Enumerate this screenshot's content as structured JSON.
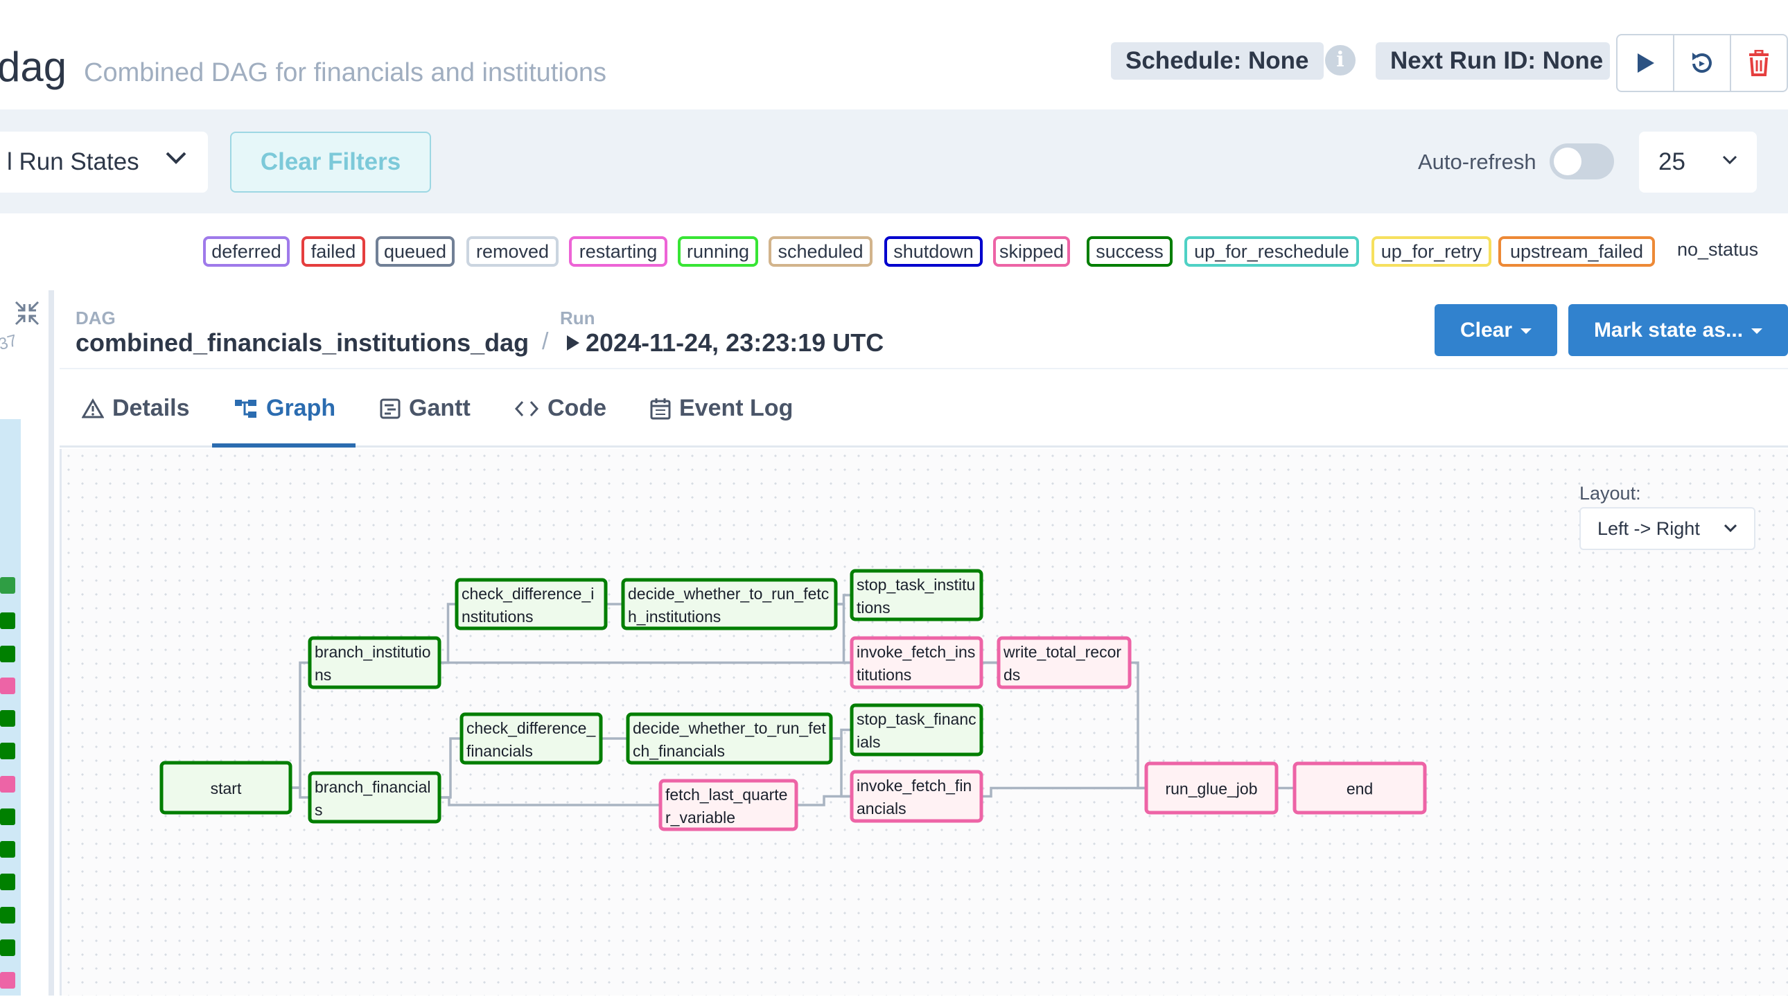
{
  "header": {
    "title_fragment": "dag",
    "description": "Combined DAG for financials and institutions",
    "schedule": "Schedule: None",
    "info_glyph": "i",
    "next_run": "Next Run ID: None",
    "actions": [
      "play-icon",
      "reparse-icon",
      "trash-icon"
    ]
  },
  "filters": {
    "run_states": "l Run States",
    "clear_filters": "Clear Filters",
    "auto_refresh_label": "Auto-refresh",
    "auto_refresh_on": false,
    "page_size": "25"
  },
  "legend": [
    {
      "label": "deferred",
      "color": "#9f7aea"
    },
    {
      "label": "failed",
      "color": "#e53e3e"
    },
    {
      "label": "queued",
      "color": "#718096"
    },
    {
      "label": "removed",
      "color": "#cbd5e0"
    },
    {
      "label": "restarting",
      "color": "#ed64d6"
    },
    {
      "label": "running",
      "color": "#38e535"
    },
    {
      "label": "scheduled",
      "color": "#d2b48c"
    },
    {
      "label": "shutdown",
      "color": "#0000cd"
    },
    {
      "label": "skipped",
      "color": "#ed64a6"
    },
    {
      "label": "success",
      "color": "#007e00"
    },
    {
      "label": "up_for_reschedule",
      "color": "#4fd1c5"
    },
    {
      "label": "up_for_retry",
      "color": "#f6e05e"
    },
    {
      "label": "upstream_failed",
      "color": "#ed8936"
    }
  ],
  "legend_no_status": "no_status",
  "sidebar": {
    "fragment": "37",
    "collapse_icon": "collapse-icon"
  },
  "detail": {
    "dag_label": "DAG",
    "dag_id": "combined_financials_institutions_dag",
    "separator": "/",
    "run_label": "Run",
    "run_date": "2024-11-24, 23:23:19 UTC",
    "clear_button": "Clear",
    "mark_button": "Mark state as..."
  },
  "tabs": [
    {
      "label": "Details",
      "icon": "warning-icon",
      "active": false
    },
    {
      "label": "Graph",
      "icon": "graph-icon",
      "active": true
    },
    {
      "label": "Gantt",
      "icon": "gantt-icon",
      "active": false
    },
    {
      "label": "Code",
      "icon": "code-icon",
      "active": false
    },
    {
      "label": "Event Log",
      "icon": "calendar-icon",
      "active": false
    }
  ],
  "graph": {
    "layout_label": "Layout:",
    "layout_value": "Left -> Right",
    "nodes": [
      {
        "id": "start",
        "lines": [
          "start"
        ],
        "state": "success"
      },
      {
        "id": "branch_institutions",
        "lines": [
          "branch_institutio",
          "ns"
        ],
        "state": "success"
      },
      {
        "id": "branch_financials",
        "lines": [
          "branch_financial",
          "s"
        ],
        "state": "success"
      },
      {
        "id": "check_difference_institutions",
        "lines": [
          "check_difference_i",
          "nstitutions"
        ],
        "state": "success"
      },
      {
        "id": "decide_whether_to_run_fetch_institutions",
        "lines": [
          "decide_whether_to_run_fetc",
          "h_institutions"
        ],
        "state": "success"
      },
      {
        "id": "check_difference_financials",
        "lines": [
          "check_difference_",
          "financials"
        ],
        "state": "success"
      },
      {
        "id": "decide_whether_to_run_fetch_financials",
        "lines": [
          "decide_whether_to_run_fet",
          "ch_financials"
        ],
        "state": "success"
      },
      {
        "id": "fetch_last_quarter_variable",
        "lines": [
          "fetch_last_quarte",
          "r_variable"
        ],
        "state": "skipped"
      },
      {
        "id": "stop_task_institutions",
        "lines": [
          "stop_task_institu",
          "tions"
        ],
        "state": "success"
      },
      {
        "id": "invoke_fetch_institutions",
        "lines": [
          "invoke_fetch_ins",
          "titutions"
        ],
        "state": "skipped"
      },
      {
        "id": "stop_task_financials",
        "lines": [
          "stop_task_financ",
          "ials"
        ],
        "state": "success"
      },
      {
        "id": "invoke_fetch_financials",
        "lines": [
          "invoke_fetch_fin",
          "ancials"
        ],
        "state": "skipped"
      },
      {
        "id": "write_total_records",
        "lines": [
          "write_total_recor",
          "ds"
        ],
        "state": "skipped"
      },
      {
        "id": "run_glue_job",
        "lines": [
          "run_glue_job"
        ],
        "state": "skipped"
      },
      {
        "id": "end",
        "lines": [
          "end"
        ],
        "state": "skipped"
      }
    ],
    "edges": [
      [
        "start",
        "branch_institutions"
      ],
      [
        "start",
        "branch_financials"
      ],
      [
        "branch_institutions",
        "check_difference_institutions"
      ],
      [
        "branch_institutions",
        "write_total_records"
      ],
      [
        "check_difference_institutions",
        "decide_whether_to_run_fetch_institutions"
      ],
      [
        "decide_whether_to_run_fetch_institutions",
        "stop_task_institutions"
      ],
      [
        "decide_whether_to_run_fetch_institutions",
        "invoke_fetch_institutions"
      ],
      [
        "invoke_fetch_institutions",
        "write_total_records"
      ],
      [
        "branch_financials",
        "check_difference_financials"
      ],
      [
        "branch_financials",
        "fetch_last_quarter_variable"
      ],
      [
        "check_difference_financials",
        "decide_whether_to_run_fetch_financials"
      ],
      [
        "decide_whether_to_run_fetch_financials",
        "stop_task_financials"
      ],
      [
        "decide_whether_to_run_fetch_financials",
        "invoke_fetch_financials"
      ],
      [
        "fetch_last_quarter_variable",
        "invoke_fetch_financials"
      ],
      [
        "write_total_records",
        "run_glue_job"
      ],
      [
        "invoke_fetch_financials",
        "run_glue_job"
      ],
      [
        "run_glue_job",
        "end"
      ]
    ],
    "state_colors": {
      "success": {
        "stroke": "#007e00",
        "fill": "#eefaec"
      },
      "skipped": {
        "stroke": "#ed64a6",
        "fill": "#fff2f4"
      }
    }
  },
  "grid_strip": {
    "cell_states": [
      "running",
      "success",
      "success",
      "skipped",
      "success",
      "success",
      "skipped",
      "success",
      "success",
      "success",
      "success",
      "success",
      "skipped"
    ]
  }
}
